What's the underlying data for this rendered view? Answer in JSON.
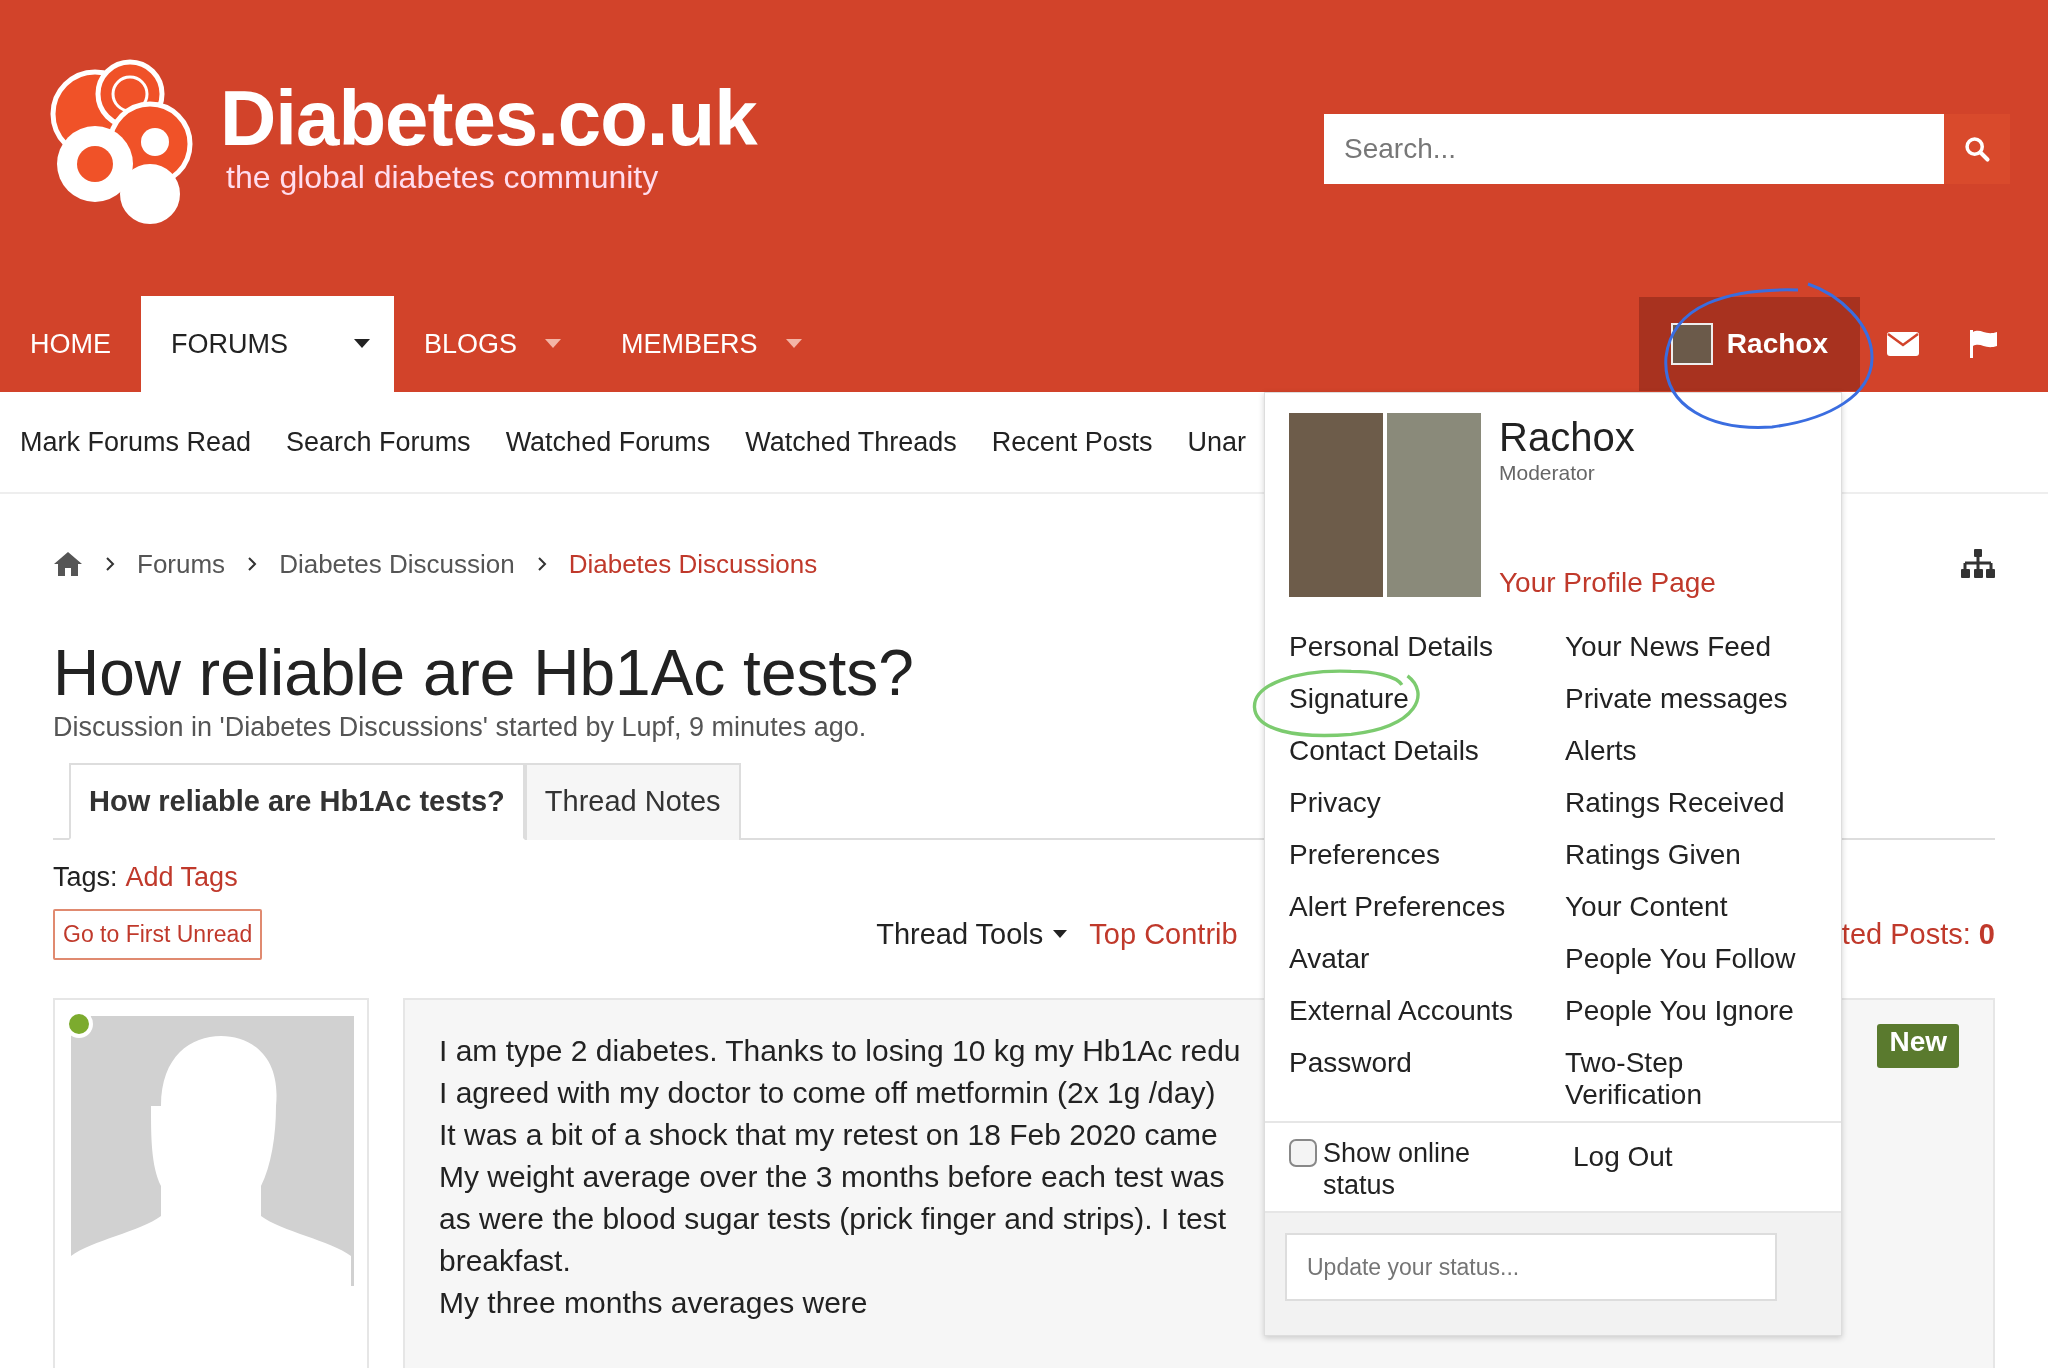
{
  "header": {
    "logo_title": "Diabetes.co.uk",
    "logo_tagline": "the global diabetes community",
    "search": {
      "placeholder": "Search..."
    }
  },
  "nav": {
    "items": [
      {
        "label": "HOME",
        "selected": false,
        "dropdown": false
      },
      {
        "label": "FORUMS",
        "selected": true,
        "dropdown": true
      },
      {
        "label": "BLOGS",
        "selected": false,
        "dropdown": true
      },
      {
        "label": "MEMBERS",
        "selected": false,
        "dropdown": true
      }
    ],
    "user": {
      "name": "Rachox",
      "open": true
    }
  },
  "subnav": [
    "Mark Forums Read",
    "Search Forums",
    "Watched Forums",
    "Watched Threads",
    "Recent Posts",
    "Unar"
  ],
  "breadcrumb": {
    "items": [
      "Forums",
      "Diabetes Discussion"
    ],
    "current": "Diabetes Discussions"
  },
  "thread": {
    "title": "How reliable are Hb1Ac tests?",
    "meta": "Discussion in 'Diabetes Discussions' started by Lupf, 9 minutes ago.",
    "tabs": [
      {
        "label": "How reliable are Hb1Ac tests?",
        "selected": true
      },
      {
        "label": "Thread Notes",
        "selected": false
      }
    ],
    "tags_label": "Tags:",
    "add_tags": "Add Tags",
    "first_unread": "Go to First Unread",
    "thread_tools": "Thread Tools",
    "top_contrib": "Top Contrib",
    "selected_posts": "ted Posts:",
    "selected_count": "0"
  },
  "post": {
    "online": true,
    "badge": "New",
    "lines": [
      "I am type 2 diabetes. Thanks to losing 10 kg my Hb1Ac redu",
      "I agreed with my doctor to come off metformin (2x 1g /day)",
      "It was a bit of a shock that my retest on 18 Feb 2020 came",
      "My weight average over the 3 months before each test was",
      "as were the blood sugar tests (prick finger and strips). I test",
      "breakfast.",
      "My three months averages were"
    ]
  },
  "user_menu": {
    "name": "Rachox",
    "role": "Moderator",
    "profile_link": "Your Profile Page",
    "left": [
      "Personal Details",
      "Signature",
      "Contact Details",
      "Privacy",
      "Preferences",
      "Alert Preferences",
      "Avatar",
      "External Accounts",
      "Password"
    ],
    "right": [
      "Your News Feed",
      "Private messages",
      "Alerts",
      "Ratings Received",
      "Ratings Given",
      "Your Content",
      "People You Follow",
      "People You Ignore",
      "Two-Step Verification"
    ],
    "show_online": {
      "label": "Show online status",
      "checked": false
    },
    "logout": "Log Out",
    "status_placeholder": "Update your status..."
  }
}
